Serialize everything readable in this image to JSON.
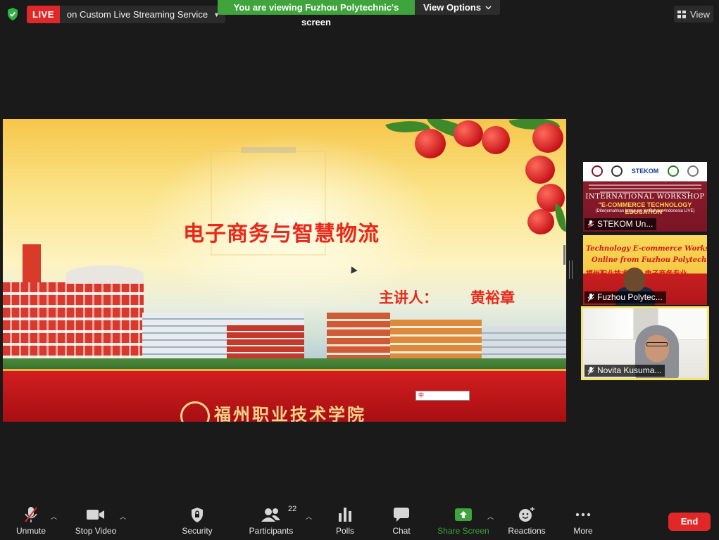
{
  "topbar": {
    "live_label": "LIVE",
    "live_service": "on Custom Live Streaming Service",
    "viewing_banner": "You are viewing Fuzhou Polytechnic's screen",
    "view_options": "View Options",
    "view_button": "View"
  },
  "slide": {
    "title": "电子商务与智慧物流",
    "speaker_label": "主讲人：",
    "speaker_name": "黄裕章",
    "school_name": "福州职业技术学院",
    "ime_text": "中"
  },
  "participants_panel": [
    {
      "name": "STEKOM Un...",
      "content": {
        "workshop_title": "INTERNATIONAL WORKSHOP",
        "workshop_subtitle": "\"E-COMMERCE TECHNOLOGY EDUCATION\"",
        "workshop_note": "(Diterjemahkan langsung ke Bahasa Indonesia LIVE)",
        "logo_text": "STEKOM"
      }
    },
    {
      "name": "Fuzhou Polytec...",
      "content": {
        "line1": "Technology E-commerce Workshop",
        "line2": "Online from Fuzhou Polytechnic",
        "line3": "福州职业技术学院 电子商务专业"
      }
    },
    {
      "name": "Novita Kusuma...",
      "active": true
    }
  ],
  "toolbar": {
    "unmute": "Unmute",
    "stop_video": "Stop Video",
    "security": "Security",
    "participants": "Participants",
    "participants_count": "22",
    "polls": "Polls",
    "chat": "Chat",
    "share_screen": "Share Screen",
    "reactions": "Reactions",
    "more": "More",
    "end": "End"
  },
  "colors": {
    "live_red": "#e02828",
    "viewing_green": "#3ea43b",
    "active_speaker": "#f2e36a",
    "background": "#1a1a1a"
  }
}
